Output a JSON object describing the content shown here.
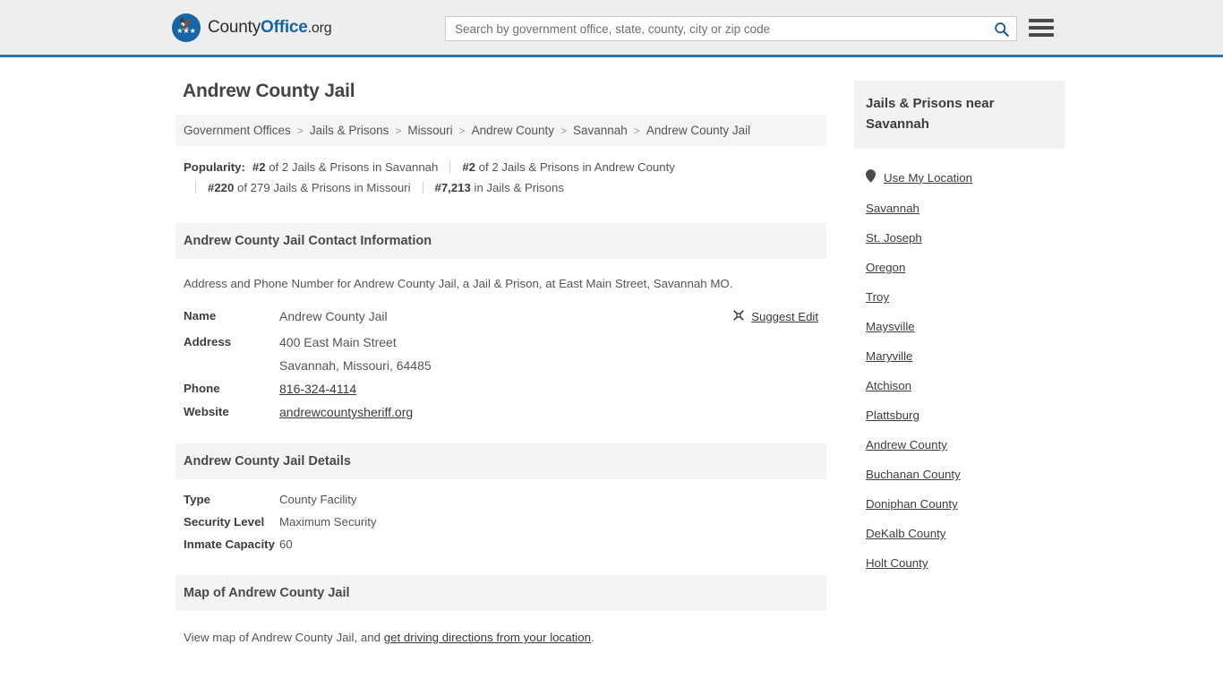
{
  "header": {
    "logo": {
      "part1": "County",
      "part2": "Office",
      "part3": ".org",
      "icon": "eagle-seal-icon"
    },
    "search": {
      "placeholder": "Search by government office, state, county, city or zip code",
      "value": "",
      "icon": "search-icon"
    },
    "menu_icon": "hamburger-menu-icon",
    "accent_color": "#3a72a8"
  },
  "page_title": "Andrew County Jail",
  "breadcrumb": [
    "Government Offices",
    "Jails & Prisons",
    "Missouri",
    "Andrew County",
    "Savannah",
    "Andrew County Jail"
  ],
  "popularity": {
    "label": "Popularity:",
    "items": [
      {
        "rank": "#2",
        "text": "of 2 Jails & Prisons in Savannah"
      },
      {
        "rank": "#2",
        "text": "of 2 Jails & Prisons in Andrew County"
      },
      {
        "rank": "#220",
        "text": "of 279 Jails & Prisons in Missouri"
      },
      {
        "rank": "#7,213",
        "text": "in Jails & Prisons"
      }
    ]
  },
  "contact": {
    "heading": "Andrew County Jail Contact Information",
    "lead": "Address and Phone Number for Andrew County Jail, a Jail & Prison, at East Main Street, Savannah MO.",
    "suggest_edit": {
      "label": "Suggest Edit",
      "icon": "edit-pencil-icon"
    },
    "rows": [
      {
        "key": "Name",
        "value": "Andrew County Jail",
        "link": false
      },
      {
        "key": "Address",
        "value": "400 East Main Street",
        "link": false
      },
      {
        "key": "",
        "value": "Savannah, Missouri, 64485",
        "link": false
      },
      {
        "key": "Phone",
        "value": "816-324-4114",
        "link": true
      },
      {
        "key": "Website",
        "value": "andrewcountysheriff.org",
        "link": true
      }
    ]
  },
  "details": {
    "heading": "Andrew County Jail Details",
    "rows": [
      {
        "key": "Type",
        "value": "County Facility"
      },
      {
        "key": "Security Level",
        "value": "Maximum Security"
      },
      {
        "key": "Inmate Capacity",
        "value": "60"
      }
    ]
  },
  "map": {
    "heading": "Map of Andrew County Jail",
    "text_before": "View map of Andrew County Jail, and ",
    "link": "get driving directions from your location",
    "text_after": "."
  },
  "sidebar": {
    "heading": "Jails & Prisons near Savannah",
    "use_my_location": {
      "label": "Use My Location",
      "icon": "map-pin-icon"
    },
    "items": [
      {
        "label": "Savannah"
      },
      {
        "label": "St. Joseph"
      },
      {
        "label": "Oregon"
      },
      {
        "label": "Troy"
      },
      {
        "label": "Maysville"
      },
      {
        "label": "Maryville"
      },
      {
        "label": "Atchison"
      },
      {
        "label": "Plattsburg"
      },
      {
        "label": "Andrew County"
      },
      {
        "label": "Buchanan County"
      },
      {
        "label": "Doniphan County"
      },
      {
        "label": "DeKalb County"
      },
      {
        "label": "Holt County"
      }
    ]
  }
}
